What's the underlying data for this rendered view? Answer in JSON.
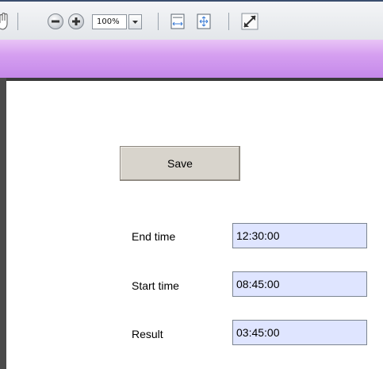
{
  "toolbar": {
    "zoom_value": "100%",
    "icons": [
      "hand-tool-icon",
      "zoom-out-icon",
      "zoom-in-icon",
      "zoom-dropdown-icon",
      "fit-width-icon",
      "fit-page-icon",
      "full-screen-icon"
    ]
  },
  "colors": {
    "purple_bar": "#c589ea",
    "input_bg": "#dfe5ff",
    "button_bg": "#d8d4cc"
  },
  "form": {
    "save_label": "Save",
    "fields": [
      {
        "label": "End time",
        "value": "12:30:00"
      },
      {
        "label": "Start time",
        "value": "08:45:00"
      },
      {
        "label": "Result",
        "value": "03:45:00"
      }
    ]
  }
}
